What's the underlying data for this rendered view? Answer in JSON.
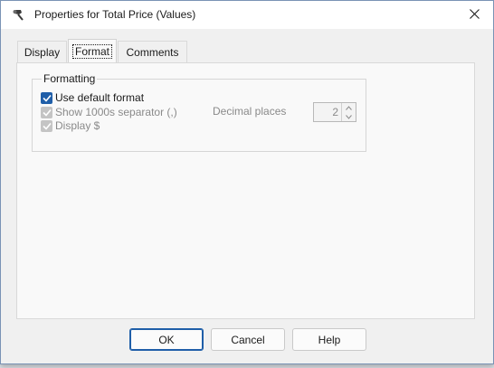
{
  "window": {
    "title": "Properties for Total Price (Values)"
  },
  "tabs": [
    {
      "label": "Display",
      "selected": false
    },
    {
      "label": "Format",
      "selected": true
    },
    {
      "label": "Comments",
      "selected": false
    }
  ],
  "formatting": {
    "group_label": "Formatting",
    "use_default": {
      "label": "Use default format",
      "checked": true,
      "enabled": true
    },
    "show_separator": {
      "label": "Show 1000s separator (,)",
      "checked": true,
      "enabled": false
    },
    "display_dollar": {
      "label": "Display $",
      "checked": true,
      "enabled": false
    },
    "decimal_places": {
      "label": "Decimal places",
      "value": "2",
      "enabled": false
    }
  },
  "buttons": {
    "ok": "OK",
    "cancel": "Cancel",
    "help": "Help"
  },
  "colors": {
    "accent": "#1f5ea8",
    "disabled_text": "#8a8a8a"
  },
  "icons": {
    "title": "pin-tool-icon",
    "close": "close-icon",
    "check": "check-icon",
    "spin_up": "chevron-up-icon",
    "spin_down": "chevron-down-icon"
  }
}
